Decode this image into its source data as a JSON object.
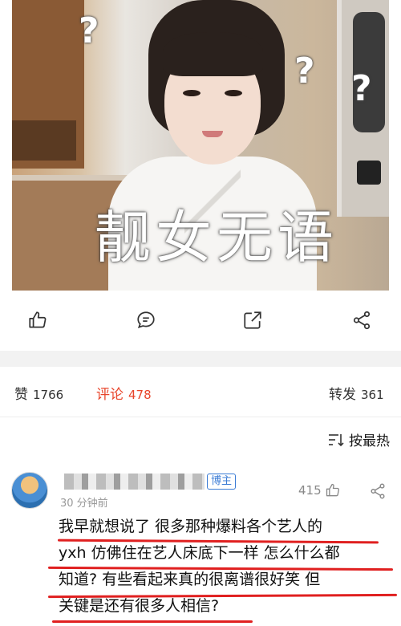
{
  "post": {
    "image_caption": "靓女无语",
    "question_marks": [
      "?",
      "?",
      "?"
    ]
  },
  "actions": {
    "icons": [
      "thumbs-up-icon",
      "comment-icon",
      "share-out-icon",
      "share-network-icon"
    ]
  },
  "stats": {
    "likes_label": "赞",
    "likes_count": "1766",
    "comments_label": "评论",
    "comments_count": "478",
    "reposts_label": "转发",
    "reposts_count": "361"
  },
  "sort": {
    "label": "按最热"
  },
  "comment": {
    "badge": "博主",
    "time": "30 分钟前",
    "likes": "415",
    "lines": [
      "我早就想说了 很多那种爆料各个艺人的",
      "yxh 仿佛住在艺人床底下一样 怎么什么都",
      "知道? 有些看起来真的很离谱很好笑 但",
      "关键是还有很多人相信?"
    ]
  },
  "colors": {
    "active_tab": "#e8452b",
    "annotation_underline": "#e02020",
    "badge": "#3a7bd5"
  }
}
